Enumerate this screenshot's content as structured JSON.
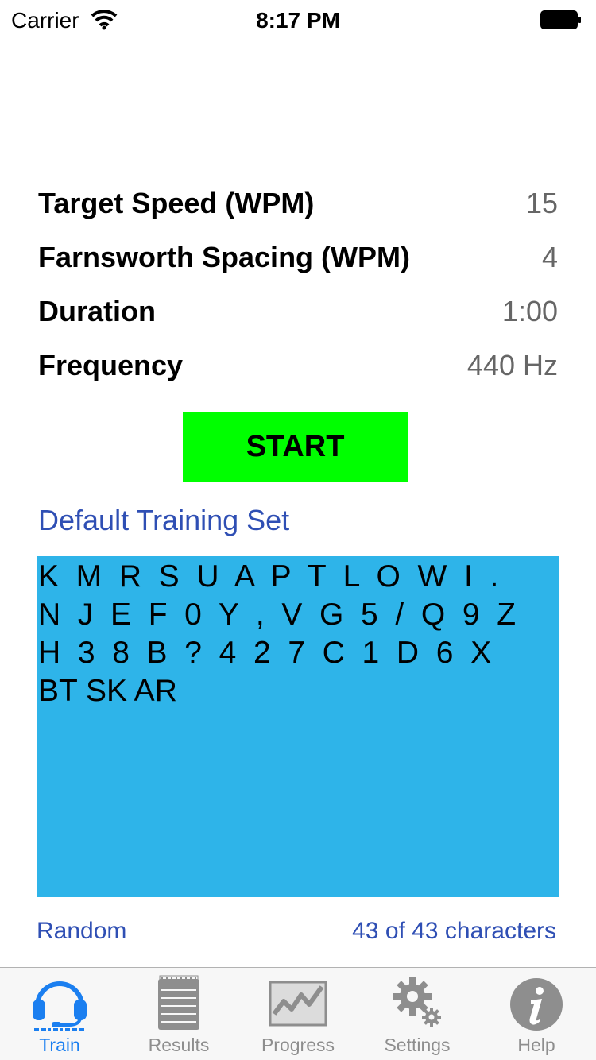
{
  "status_bar": {
    "carrier": "Carrier",
    "time": "8:17 PM"
  },
  "settings": [
    {
      "label": "Target Speed (WPM)",
      "value": "15"
    },
    {
      "label": "Farnsworth Spacing (WPM)",
      "value": "4"
    },
    {
      "label": "Duration",
      "value": "1:00"
    },
    {
      "label": "Frequency",
      "value": "440 Hz"
    }
  ],
  "start_label": "START",
  "training_set": "Default Training Set",
  "characters_text": "K  M  R  S  U  A  P  T  L  O  W  I  .\nN  J  E  F  0  Y  ,  V  G  5  /  Q  9  Z\nH  3  8  B  ?  4  2  7  C  1  D  6  X\nBT SK AR",
  "order_mode": "Random",
  "char_count": "43 of 43 characters",
  "tabs": [
    {
      "label": "Train",
      "icon": "headset-icon",
      "active": true
    },
    {
      "label": "Results",
      "icon": "notepad-icon",
      "active": false
    },
    {
      "label": "Progress",
      "icon": "chart-icon",
      "active": false
    },
    {
      "label": "Settings",
      "icon": "gears-icon",
      "active": false
    },
    {
      "label": "Help",
      "icon": "info-icon",
      "active": false
    }
  ],
  "colors": {
    "start_button": "#00ff00",
    "character_panel": "#2eb4e9",
    "link": "#2f4fb4",
    "tab_active": "#1b7ff0",
    "tab_inactive": "#8e8e8e"
  }
}
